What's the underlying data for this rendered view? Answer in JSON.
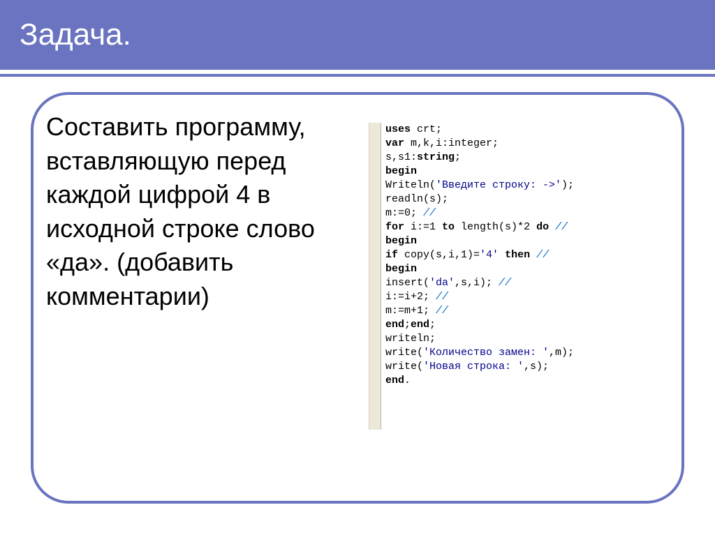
{
  "header": {
    "title": "Задача."
  },
  "task": {
    "text": "Составить программу, вставляющую перед каждой цифрой 4 в исходной строке слово «да». (добавить комментарии)"
  },
  "code": {
    "l1_a": "uses",
    "l1_b": " crt;",
    "l2_a": "var",
    "l2_b": " m,k,i:integer;",
    "l3_a": "s,s1:",
    "l3_b": "string",
    "l3_c": ";",
    "l4": "begin",
    "l5_a": "Writeln(",
    "l5_b": "'Введите строку: ->'",
    "l5_c": ");",
    "l6": "readln(s);",
    "l7_a": "m:=0;  ",
    "l7_b": "//",
    "l8_a": "for",
    "l8_b": " i:=1 ",
    "l8_c": "to",
    "l8_d": " length(s)*2 ",
    "l8_e": "do",
    "l8_f": "  ",
    "l8_g": "//",
    "l9": "begin",
    "l10_a": "if",
    "l10_b": " copy(s,i,1)=",
    "l10_c": "'4'",
    "l10_d": " ",
    "l10_e": "then",
    "l10_f": " ",
    "l10_g": "//",
    "l11": "begin",
    "l12_a": "insert(",
    "l12_b": "'da'",
    "l12_c": ",s,i); ",
    "l12_d": "//",
    "l13_a": "i:=i+2; ",
    "l13_b": "//",
    "l14_a": "m:=m+1; ",
    "l14_b": "//",
    "l15_a": "end",
    "l15_b": ";",
    "l15_c": "end",
    "l15_d": ";",
    "l16": "writeln;",
    "l17_a": "write(",
    "l17_b": "'Количество замен: '",
    "l17_c": ",m);",
    "l18_a": "write(",
    "l18_b": "'Новая строка: '",
    "l18_c": ",s);",
    "l19_a": "end",
    "l19_b": "."
  }
}
